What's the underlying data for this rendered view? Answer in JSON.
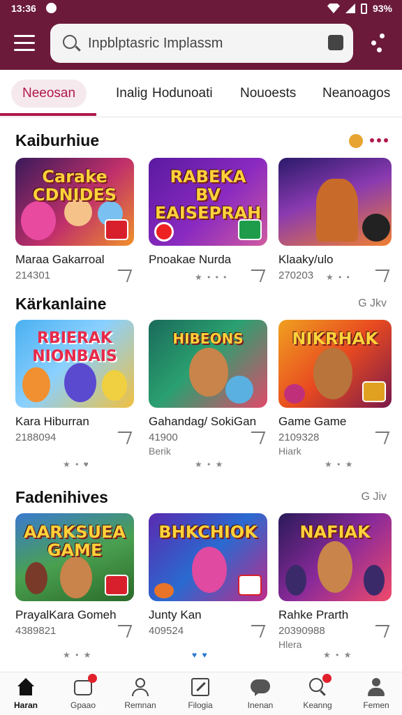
{
  "status_bar": {
    "time": "13:36",
    "battery": "93%"
  },
  "search": {
    "placeholder": "Inpblptasric Implassm"
  },
  "tabs": [
    {
      "label": "Neeosan",
      "active": true
    },
    {
      "label": "Inalig"
    },
    {
      "label": "Hodunoati"
    },
    {
      "label": "Nouoests"
    },
    {
      "label": "Neanoagos"
    }
  ],
  "sections": [
    {
      "title": "Kaiburhiue",
      "action": "",
      "cards": [
        {
          "thumb_text": "Carake\nCDNIDES",
          "title": "Maraa Gakarroal",
          "meta": "214301",
          "sub": ""
        },
        {
          "thumb_text": "RABEKA\nBV\nEAISEPRAH",
          "title": "Pnoakae Nurda",
          "meta": "",
          "sub": ""
        },
        {
          "thumb_text": "",
          "title": "Klaaky/ulo",
          "meta": "270203",
          "sub": ""
        }
      ]
    },
    {
      "title": "Kärkanlaine",
      "action": "G Jkv",
      "cards": [
        {
          "thumb_text": "RBIERAK\nNIONBAIS",
          "title": "Kara Hiburran",
          "meta": "2188094",
          "sub": ""
        },
        {
          "thumb_text": "HIBEONS",
          "title": "Gahandag/ SokiGan",
          "meta": "41900",
          "sub": "Berik"
        },
        {
          "thumb_text": "NIKRHAK",
          "title": "Game Game",
          "meta": "2109328",
          "sub": "Hiark"
        }
      ]
    },
    {
      "title": "Fadenihives",
      "action": "G Jiv",
      "cards": [
        {
          "thumb_text": "AARKSUEA\nGAME",
          "title": "PrayalKara Gomeh",
          "meta": "4389821",
          "sub": ""
        },
        {
          "thumb_text": "BHKCHIOK",
          "title": "Junty Kan",
          "meta": "409524",
          "sub": ""
        },
        {
          "thumb_text": "NAFIAK",
          "title": "Rahke Prarth",
          "meta": "20390988",
          "sub": "Hlera"
        }
      ]
    }
  ],
  "bottom_nav": [
    {
      "label": "Haran",
      "icon": "home-icon",
      "active": true
    },
    {
      "label": "Gpaao",
      "icon": "gamepad-icon",
      "notify": true
    },
    {
      "label": "Remnan",
      "icon": "user-icon"
    },
    {
      "label": "Filogia",
      "icon": "edit-icon"
    },
    {
      "label": "Inenan",
      "icon": "chat-icon"
    },
    {
      "label": "Keanng",
      "icon": "search-icon",
      "notify": true
    },
    {
      "label": "Femen",
      "icon": "profile-icon"
    }
  ],
  "colors": {
    "header": "#6b1a3a",
    "accent": "#b0174a"
  }
}
